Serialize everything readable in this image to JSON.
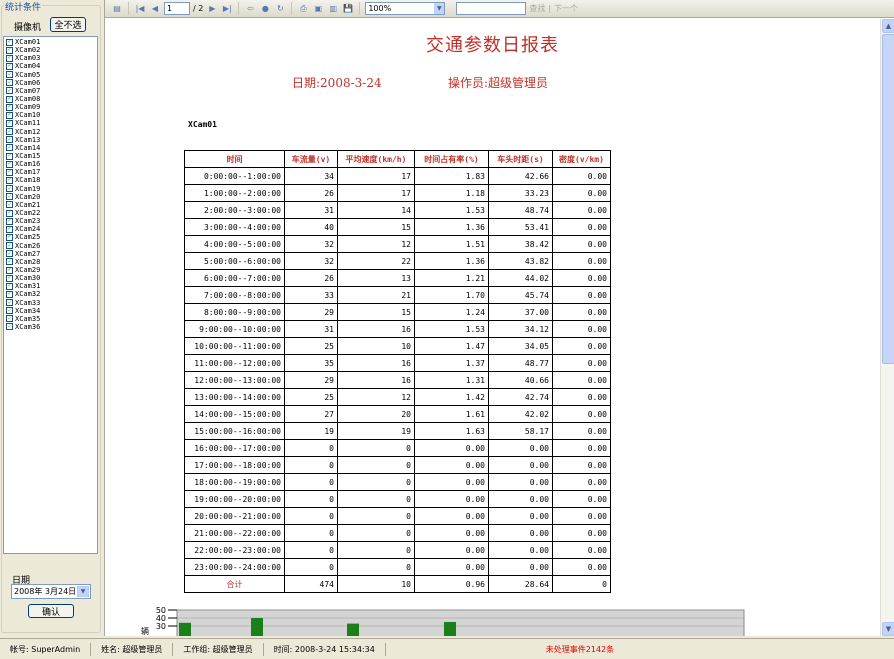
{
  "left_panel": {
    "group_title": "统计条件",
    "camera_label": "摄像机",
    "select_none_button": "全不选",
    "cameras": [
      "XCam01",
      "XCam02",
      "XCam03",
      "XCam04",
      "XCam05",
      "XCam06",
      "XCam07",
      "XCam08",
      "XCam09",
      "XCam10",
      "XCam11",
      "XCam12",
      "XCam13",
      "XCam14",
      "XCam15",
      "XCam16",
      "XCam17",
      "XCam18",
      "XCam19",
      "XCam20",
      "XCam21",
      "XCam22",
      "XCam23",
      "XCam24",
      "XCam25",
      "XCam26",
      "XCam27",
      "XCam28",
      "XCam29",
      "XCam30",
      "XCam31",
      "XCam32",
      "XCam33",
      "XCam34",
      "XCam35",
      "XCam36"
    ],
    "date_label": "日期",
    "date_value": "2008年 3月24日",
    "ok_button": "确认"
  },
  "toolbar": {
    "page_value": "1",
    "page_total": "/ 2",
    "zoom_value": "100%",
    "find_label": "查找",
    "next_label": "下一个"
  },
  "report": {
    "title": "交通参数日报表",
    "date_text": "日期:2008-3-24",
    "operator_text": "操作员:超级管理员",
    "camera_name": "XCam01",
    "columns": [
      "时间",
      "车流量(v)",
      "平均速度(km/h)",
      "时间占有率(%)",
      "车头时距(s)",
      "密度(v/km)"
    ],
    "rows": [
      [
        "0:00:00--1:00:00",
        "34",
        "17",
        "1.83",
        "42.66",
        "0.00"
      ],
      [
        "1:00:00--2:00:00",
        "26",
        "17",
        "1.18",
        "33.23",
        "0.00"
      ],
      [
        "2:00:00--3:00:00",
        "31",
        "14",
        "1.53",
        "48.74",
        "0.00"
      ],
      [
        "3:00:00--4:00:00",
        "40",
        "15",
        "1.36",
        "53.41",
        "0.00"
      ],
      [
        "4:00:00--5:00:00",
        "32",
        "12",
        "1.51",
        "38.42",
        "0.00"
      ],
      [
        "5:00:00--6:00:00",
        "32",
        "22",
        "1.36",
        "43.82",
        "0.00"
      ],
      [
        "6:00:00--7:00:00",
        "26",
        "13",
        "1.21",
        "44.02",
        "0.00"
      ],
      [
        "7:00:00--8:00:00",
        "33",
        "21",
        "1.70",
        "45.74",
        "0.00"
      ],
      [
        "8:00:00--9:00:00",
        "29",
        "15",
        "1.24",
        "37.00",
        "0.00"
      ],
      [
        "9:00:00--10:00:00",
        "31",
        "16",
        "1.53",
        "34.12",
        "0.00"
      ],
      [
        "10:00:00--11:00:00",
        "25",
        "10",
        "1.47",
        "34.05",
        "0.00"
      ],
      [
        "11:00:00--12:00:00",
        "35",
        "16",
        "1.37",
        "48.77",
        "0.00"
      ],
      [
        "12:00:00--13:00:00",
        "29",
        "16",
        "1.31",
        "40.66",
        "0.00"
      ],
      [
        "13:00:00--14:00:00",
        "25",
        "12",
        "1.42",
        "42.74",
        "0.00"
      ],
      [
        "14:00:00--15:00:00",
        "27",
        "20",
        "1.61",
        "42.02",
        "0.00"
      ],
      [
        "15:00:00--16:00:00",
        "19",
        "19",
        "1.63",
        "58.17",
        "0.00"
      ],
      [
        "16:00:00--17:00:00",
        "0",
        "0",
        "0.00",
        "0.00",
        "0.00"
      ],
      [
        "17:00:00--18:00:00",
        "0",
        "0",
        "0.00",
        "0.00",
        "0.00"
      ],
      [
        "18:00:00--19:00:00",
        "0",
        "0",
        "0.00",
        "0.00",
        "0.00"
      ],
      [
        "19:00:00--20:00:00",
        "0",
        "0",
        "0.00",
        "0.00",
        "0.00"
      ],
      [
        "20:00:00--21:00:00",
        "0",
        "0",
        "0.00",
        "0.00",
        "0.00"
      ],
      [
        "21:00:00--22:00:00",
        "0",
        "0",
        "0.00",
        "0.00",
        "0.00"
      ],
      [
        "22:00:00--23:00:00",
        "0",
        "0",
        "0.00",
        "0.00",
        "0.00"
      ],
      [
        "23:00:00--24:00:00",
        "0",
        "0",
        "0.00",
        "0.00",
        "0.00"
      ]
    ],
    "total_row": [
      "合计",
      "474",
      "10",
      "0.96",
      "28.64",
      "0"
    ]
  },
  "chart_data": {
    "type": "bar",
    "yticks": [
      "50",
      "40",
      "30"
    ],
    "ylim": [
      0,
      50
    ],
    "ylabel": "辆",
    "visible_bars": [
      {
        "category": "0:00:00--1:00:00",
        "value": 34
      },
      {
        "category": "3:00:00--4:00:00",
        "value": 40
      },
      {
        "category": "7:00:00--8:00:00",
        "value": 33
      },
      {
        "category": "11:00:00--12:00:00",
        "value": 35
      }
    ],
    "bar_color": "#1b7f1b",
    "plot_background": "#d4d4d4"
  },
  "statusbar": {
    "account": "帐号: SuperAdmin",
    "name": "姓名: 超级管理员",
    "workgroup": "工作组: 超级管理员",
    "time": "时间: 2008-3-24 15:34:34",
    "alert": "未处理事件2142条"
  }
}
